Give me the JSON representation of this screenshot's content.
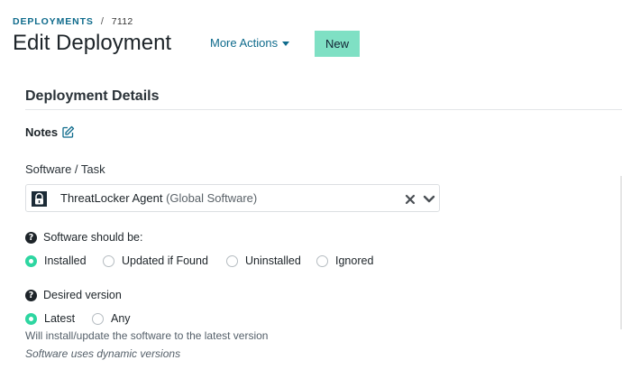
{
  "breadcrumb": {
    "parent": "DEPLOYMENTS",
    "separator": "/",
    "current": "7112"
  },
  "header": {
    "title": "Edit Deployment",
    "more_actions_label": "More Actions",
    "new_button_label": "New"
  },
  "section": {
    "title": "Deployment Details"
  },
  "notes": {
    "label": "Notes"
  },
  "software": {
    "label": "Software / Task",
    "selected_name": "ThreatLocker Agent",
    "selected_tag": "(Global Software)"
  },
  "state": {
    "label": "Software should be:",
    "options": [
      {
        "label": "Installed",
        "checked": true
      },
      {
        "label": "Updated if Found",
        "checked": false
      },
      {
        "label": "Uninstalled",
        "checked": false
      },
      {
        "label": "Ignored",
        "checked": false
      }
    ]
  },
  "version": {
    "label": "Desired version",
    "options": [
      {
        "label": "Latest",
        "checked": true
      },
      {
        "label": "Any",
        "checked": false
      }
    ],
    "helper": "Will install/update the software to the latest version",
    "note": "Software uses dynamic versions"
  },
  "colors": {
    "accent": "#0f6b8c",
    "new_button": "#7fe0c4",
    "radio_checked": "#2ed6a1"
  },
  "icons": [
    "edit-icon",
    "threatlocker-logo-icon",
    "clear-icon",
    "chevron-down-icon",
    "question-icon"
  ]
}
